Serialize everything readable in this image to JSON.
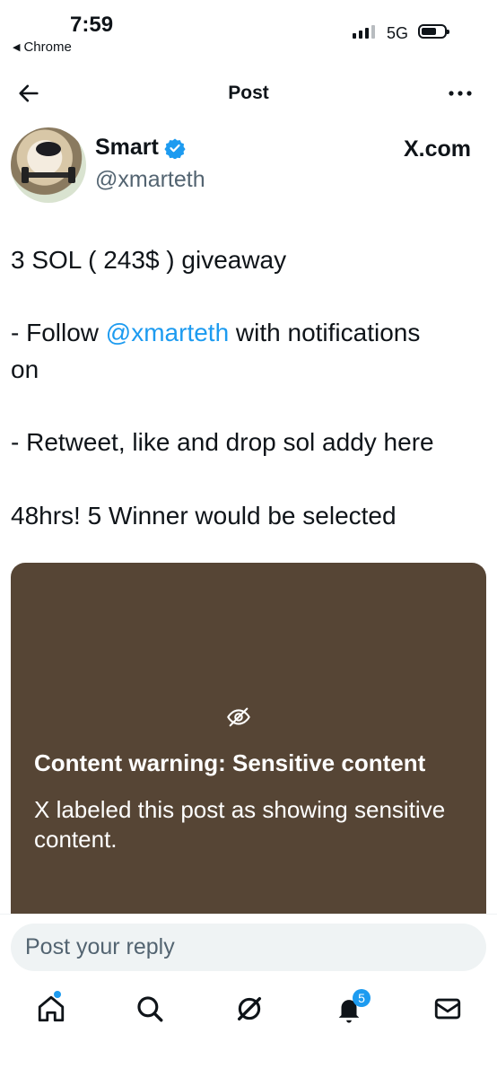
{
  "status_bar": {
    "time": "7:59",
    "back_app": "Chrome",
    "network": "5G"
  },
  "header": {
    "title": "Post"
  },
  "author": {
    "name": "Smart",
    "handle": "@xmarteth",
    "site": "X.com"
  },
  "tweet": {
    "line1": "3 SOL ( 243$ ) giveaway",
    "line2_prefix": "- Follow ",
    "line2_mention": "@xmarteth",
    "line2_suffix": " with notifications",
    "line3": "on",
    "line4": "- Retweet, like and drop sol addy here",
    "line5": "48hrs!  5 Winner would be selected"
  },
  "media_warning": {
    "title": "Content warning: Sensitive content",
    "description": "X labeled this post as showing sensitive content.",
    "card_color": "#564535"
  },
  "reply": {
    "placeholder": "Post your reply"
  },
  "bottom_nav": {
    "items": [
      {
        "icon": "home-icon"
      },
      {
        "icon": "search-icon"
      },
      {
        "icon": "grok-icon"
      },
      {
        "icon": "bell-icon"
      },
      {
        "icon": "mail-icon"
      }
    ],
    "notification_count": "5"
  },
  "colors": {
    "accent": "#1d9bf0",
    "text": "#0f1419",
    "muted": "#536471"
  }
}
